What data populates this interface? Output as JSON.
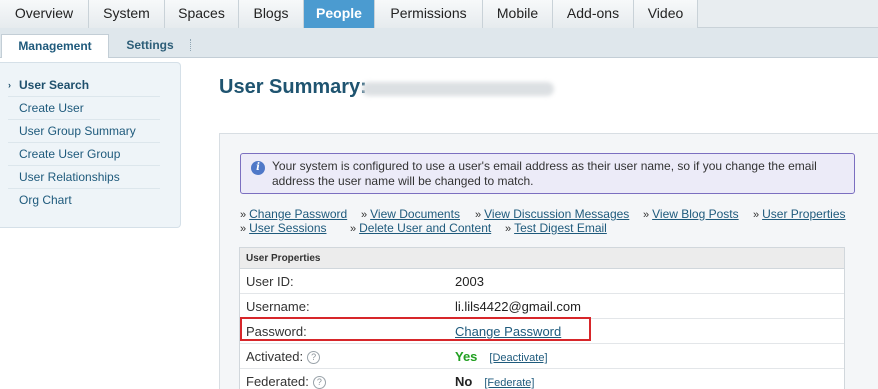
{
  "top_tabs": [
    {
      "label": "Overview"
    },
    {
      "label": "System"
    },
    {
      "label": "Spaces"
    },
    {
      "label": "Blogs"
    },
    {
      "label": "People",
      "active": true
    },
    {
      "label": "Permissions"
    },
    {
      "label": "Mobile"
    },
    {
      "label": "Add-ons"
    },
    {
      "label": "Video"
    }
  ],
  "sub_tabs": [
    {
      "label": "Management",
      "active": true
    },
    {
      "label": "Settings"
    }
  ],
  "sidebar": {
    "items": [
      {
        "label": "User Search",
        "active": true
      },
      {
        "label": "Create User"
      },
      {
        "label": "User Group Summary"
      },
      {
        "label": "Create User Group"
      },
      {
        "label": "User Relationships"
      },
      {
        "label": "Org Chart"
      }
    ]
  },
  "main": {
    "title": "User Summary:",
    "info_message": "Your system is configured to use a user's email address as their user name, so if you change the email address the user name will be changed to match.",
    "action_links_row1": [
      "Change Password",
      "View Documents",
      "View Discussion Messages",
      "View Blog Posts",
      "User Properties"
    ],
    "action_links_row2": [
      "User Sessions",
      "Delete User and Content",
      "Test Digest Email"
    ],
    "table": {
      "header": "User Properties",
      "rows": {
        "user_id": {
          "label": "User ID:",
          "value": "2003"
        },
        "username": {
          "label": "Username:",
          "value": "li.lils4422@gmail.com"
        },
        "password": {
          "label": "Password:",
          "value": "Change Password"
        },
        "activated": {
          "label": "Activated:",
          "value": "Yes",
          "action": "[Deactivate]"
        },
        "federated": {
          "label": "Federated:",
          "value": "No",
          "action": "[Federate]"
        }
      }
    }
  },
  "colors": {
    "active_tab": "#4b9bd0",
    "link": "#1e5a7c",
    "yes": "#22a022",
    "highlight": "#d7262a",
    "info_border": "#7b6fc0"
  }
}
